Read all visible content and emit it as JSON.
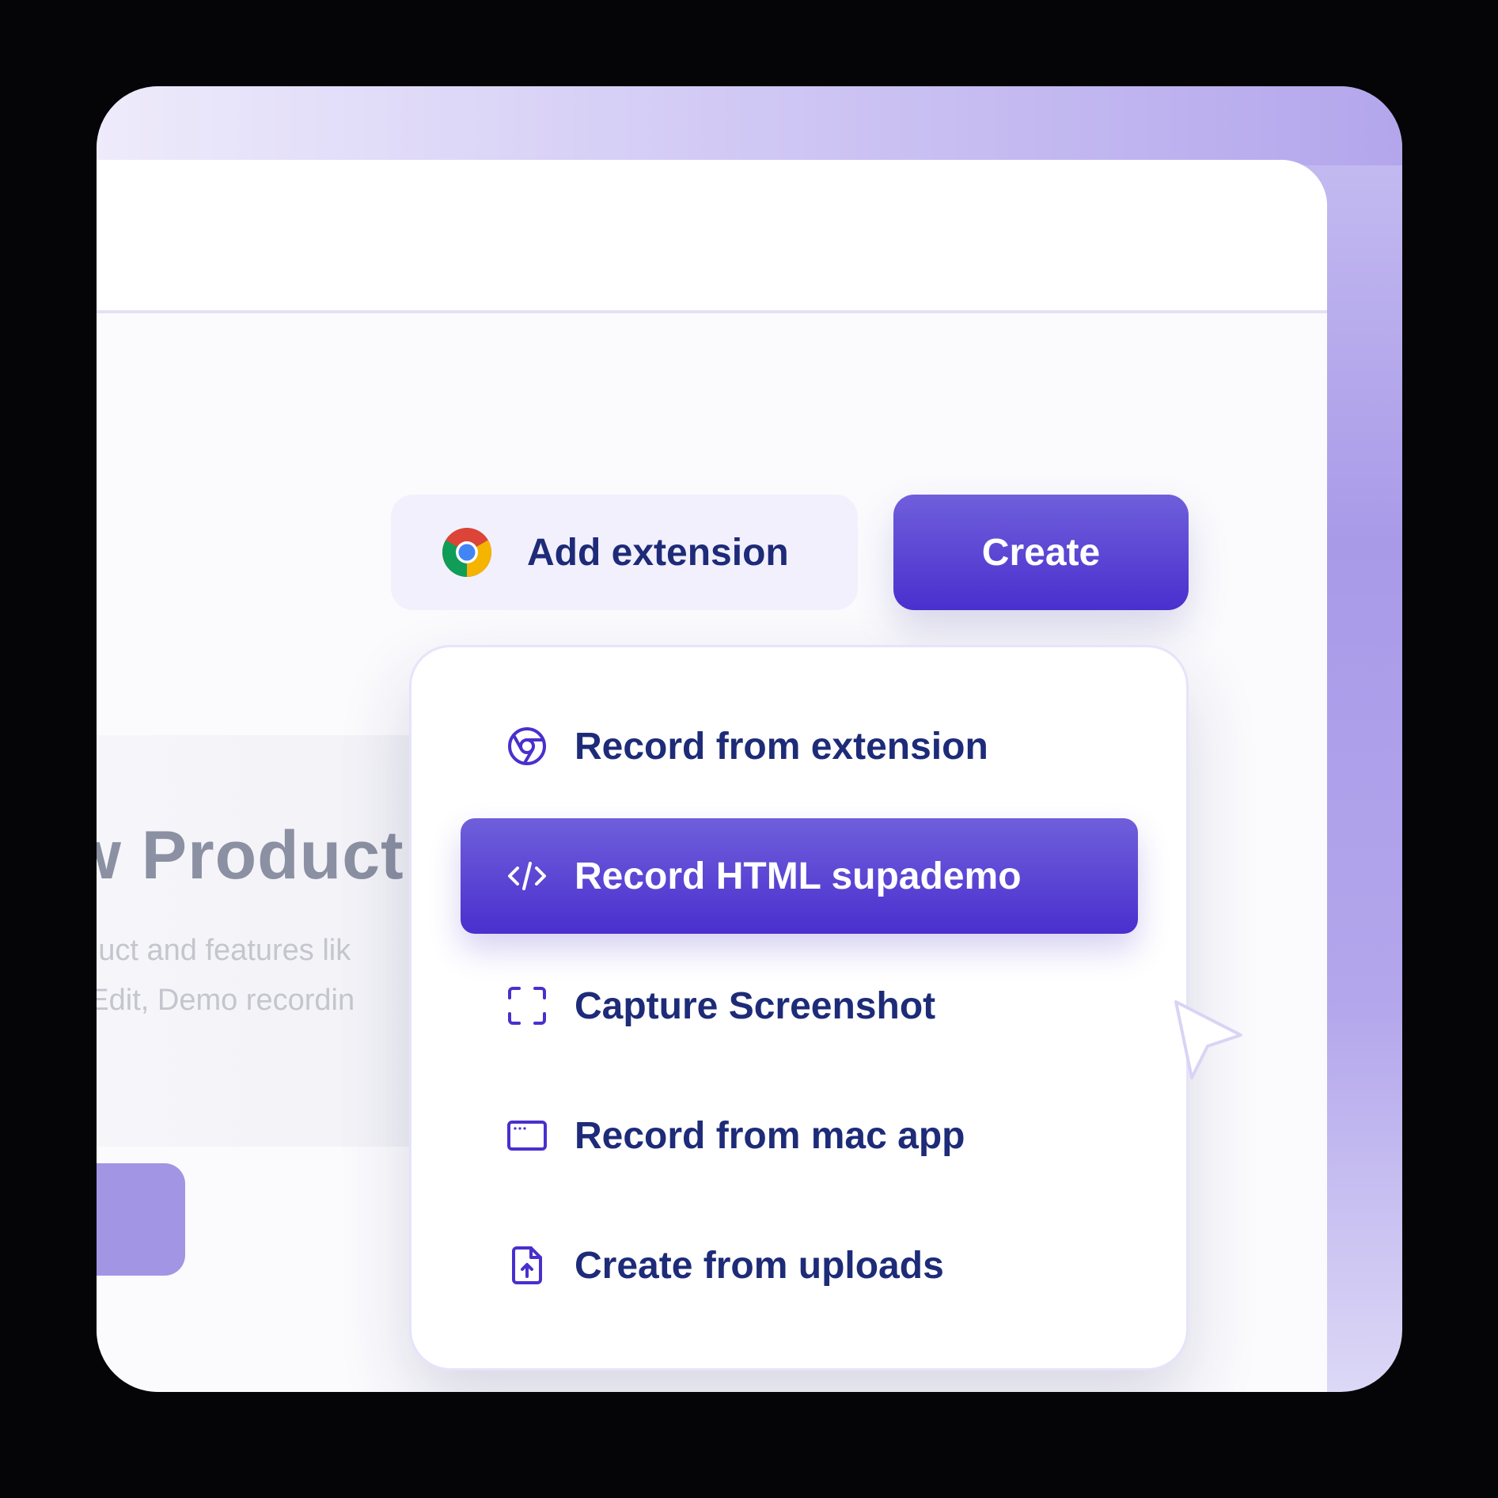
{
  "hero": {
    "title": "w Product",
    "description_line1": "oduct and features lik",
    "description_line2": "L Edit, Demo recordin"
  },
  "toolbar": {
    "extension_button": {
      "label": "Add extension",
      "icon": "chrome-logo-icon"
    },
    "create_button": {
      "label": "Create"
    }
  },
  "create_menu": {
    "items": [
      {
        "label": "Record from extension",
        "icon": "chrome-outline-icon",
        "active": false
      },
      {
        "label": "Record HTML supademo",
        "icon": "code-icon",
        "active": true
      },
      {
        "label": "Capture Screenshot",
        "icon": "screenshot-frame-icon",
        "active": false
      },
      {
        "label": "Record from mac app",
        "icon": "app-window-icon",
        "active": false
      },
      {
        "label": "Create from uploads",
        "icon": "file-upload-icon",
        "active": false
      }
    ]
  },
  "colors": {
    "brand_primary": "#4a2fce",
    "text_primary": "#1d2b78",
    "extension_bg": "#f2f0fc"
  }
}
